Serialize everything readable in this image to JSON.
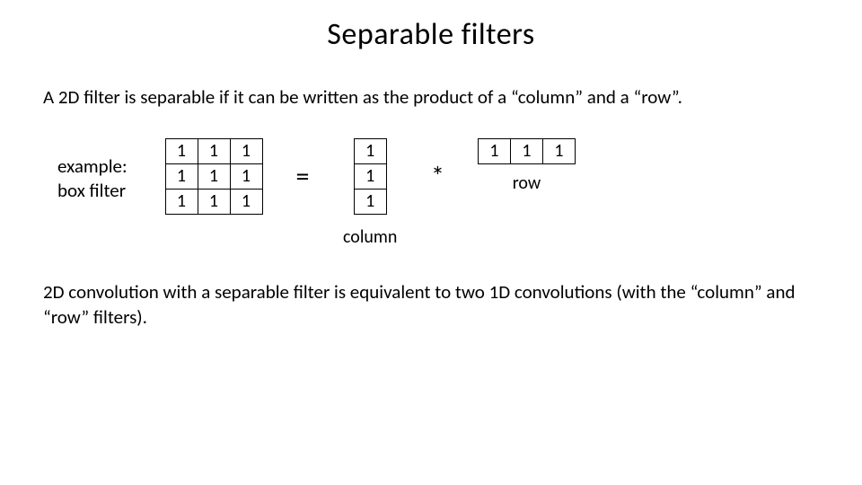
{
  "title": "Separable filters",
  "intro": "A 2D filter is separable if it can be written as the product of a “column” and a “row”.",
  "example_label_line1": "example:",
  "example_label_line2": "box filter",
  "matrix_3x3": [
    "1",
    "1",
    "1",
    "1",
    "1",
    "1",
    "1",
    "1",
    "1"
  ],
  "equals": "=",
  "column_vec": [
    "1",
    "1",
    "1"
  ],
  "column_label": "column",
  "star": "*",
  "row_vec": [
    "1",
    "1",
    "1"
  ],
  "row_label": "row",
  "conclusion": "2D convolution with a separable filter is equivalent to two 1D convolutions (with the “column” and “row” filters)."
}
